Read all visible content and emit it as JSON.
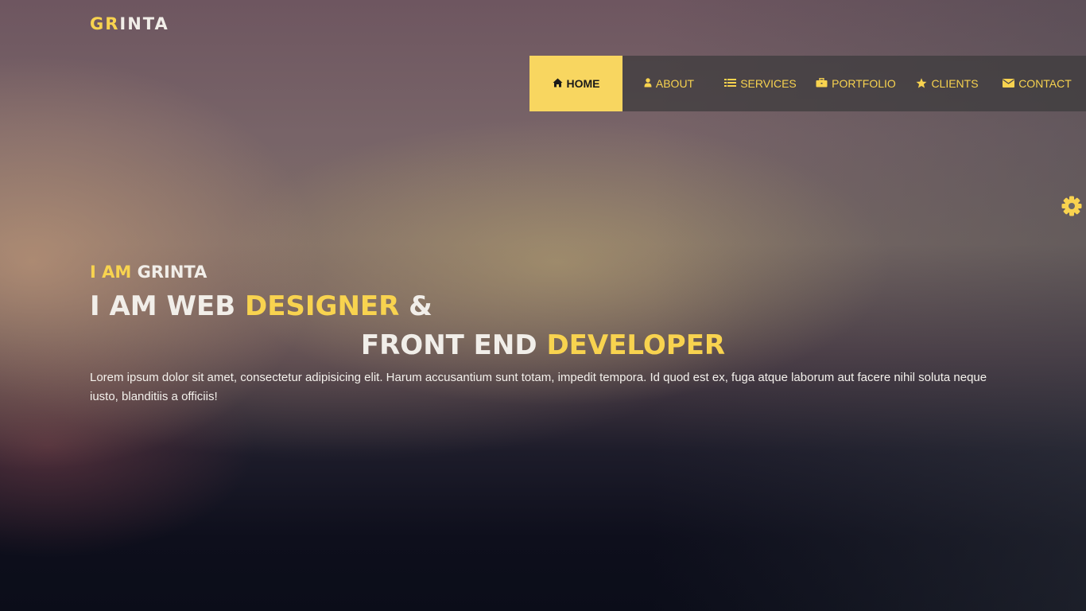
{
  "brand": {
    "logo_accent": "GR",
    "logo_rest": "INTA",
    "accent_color": "#f8d34f"
  },
  "nav": {
    "items": [
      {
        "label": "HOME",
        "icon": "home-icon",
        "active": true
      },
      {
        "label": "ABOUT",
        "icon": "user-icon",
        "active": false
      },
      {
        "label": "SERVICES",
        "icon": "list-icon",
        "active": false
      },
      {
        "label": "PORTFOLIO",
        "icon": "briefcase-icon",
        "active": false
      },
      {
        "label": "CLIENTS",
        "icon": "star-icon",
        "active": false
      },
      {
        "label": "CONTACT",
        "icon": "envelope-icon",
        "active": false
      }
    ]
  },
  "settings": {
    "icon": "gear-icon"
  },
  "hero": {
    "intro_accent": "I AM",
    "intro_name": "GRINTA",
    "line1_prefix": "I AM WEB",
    "line1_accent": "DESIGNER",
    "line1_suffix": "&",
    "line2_prefix": "FRONT END",
    "line2_accent": "DEVELOPER",
    "description": "Lorem ipsum dolor sit amet, consectetur adipisicing elit. Harum accusantium sunt totam, impedit tempora. Id quod est ex, fuga atque laborum aut facere nihil soluta neque iusto, blanditiis a officiis!"
  }
}
